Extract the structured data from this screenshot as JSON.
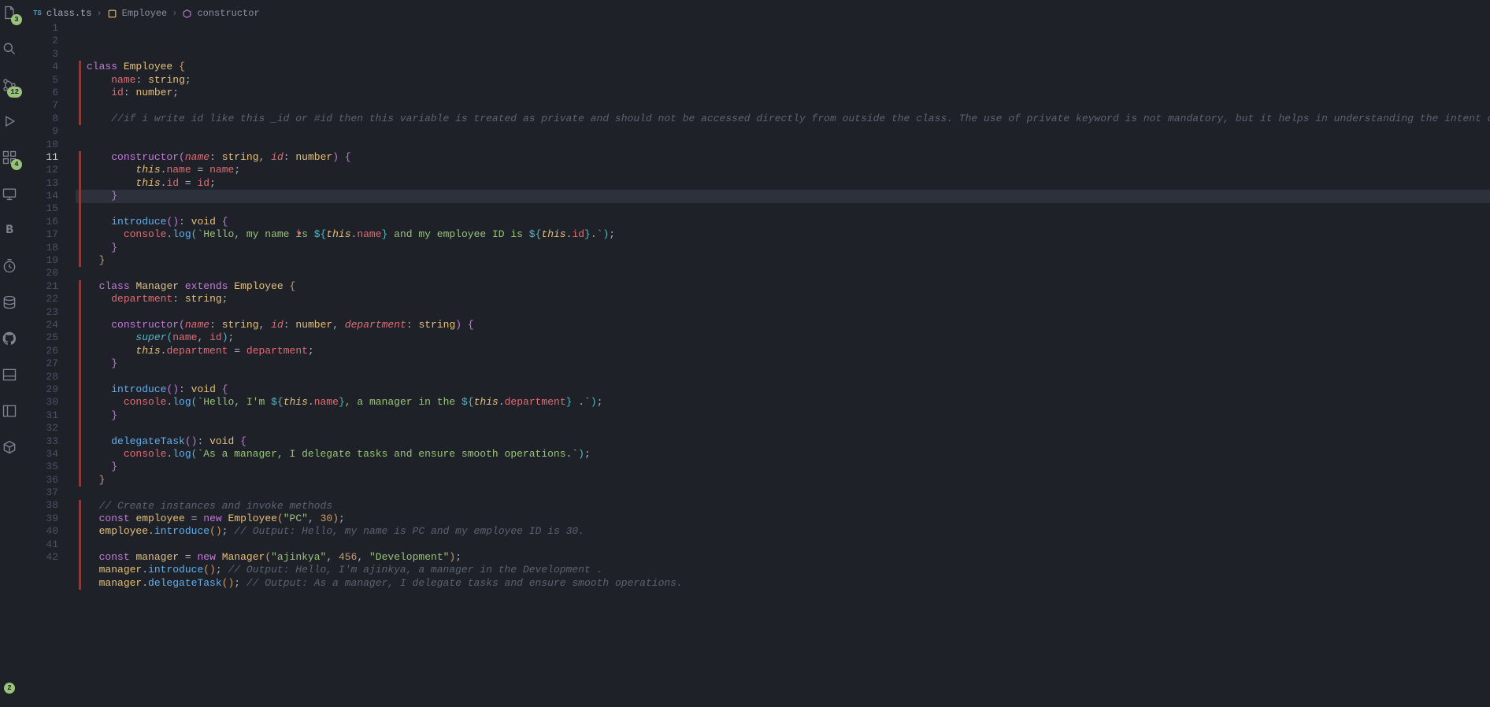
{
  "activity": {
    "badges": {
      "explorer": "3",
      "scm": "12",
      "ext": "4",
      "account": "2"
    }
  },
  "breadcrumb": {
    "tsLabel": "TS",
    "file": "class.ts",
    "class": "Employee",
    "method": "constructor"
  },
  "currentLine": 11,
  "lines": [
    {
      "n": 1,
      "mod": true,
      "html": "<span class='tok-keyword'>class</span> <span class='tok-class'>Employee</span> <span class='tok-brace1'>{</span>"
    },
    {
      "n": 2,
      "mod": true,
      "html": "    <span class='tok-prop'>name</span><span class='tok-punct'>:</span> <span class='tok-type'>string</span><span class='tok-punct'>;</span>"
    },
    {
      "n": 3,
      "mod": true,
      "html": "    <span class='tok-prop'>id</span><span class='tok-punct'>:</span> <span class='tok-type'>number</span><span class='tok-punct'>;</span>"
    },
    {
      "n": 4,
      "mod": true,
      "html": ""
    },
    {
      "n": 5,
      "mod": true,
      "html": "    <span class='tok-comment'>//if i write id like this _id or #id then this variable is treated as private and should not be accessed directly from outside the class. The use of private keyword is not mandatory, but it helps in understanding the intent of the variables. ('only for knowledge purpose')</span>"
    },
    {
      "n": 6,
      "mod": false,
      "html": ""
    },
    {
      "n": 7,
      "mod": false,
      "html": ""
    },
    {
      "n": 8,
      "mod": true,
      "html": "    <span class='tok-keyword'>constructor</span><span class='tok-brace2'>(</span><span class='tok-param'>name</span><span class='tok-punct'>:</span> <span class='tok-type'>string</span><span class='tok-punct'>,</span> <span class='tok-param'>id</span><span class='tok-punct'>:</span> <span class='tok-type'>number</span><span class='tok-brace2'>)</span> <span class='tok-brace2'>{</span>"
    },
    {
      "n": 9,
      "mod": true,
      "html": "        <span class='tok-this'>this</span><span class='tok-punct'>.</span><span class='tok-prop'>name</span> <span class='tok-punct'>=</span> <span class='tok-prop'>name</span><span class='tok-punct'>;</span>"
    },
    {
      "n": 10,
      "mod": true,
      "html": "        <span class='tok-this'>this</span><span class='tok-punct'>.</span><span class='tok-prop'>id</span> <span class='tok-punct'>=</span> <span class='tok-prop'>id</span><span class='tok-punct'>;</span>"
    },
    {
      "n": 11,
      "mod": true,
      "html": "    <span class='tok-brace2'>}</span>"
    },
    {
      "n": 12,
      "mod": true,
      "html": ""
    },
    {
      "n": 13,
      "mod": true,
      "html": "    <span class='tok-func'>introduce</span><span class='tok-brace2'>()</span><span class='tok-punct'>:</span> <span class='tok-type'>void</span> <span class='tok-brace2'>{</span>"
    },
    {
      "n": 14,
      "mod": true,
      "html": "      <span class='tok-prop'>console</span><span class='tok-punct'>.</span><span class='tok-func'>log</span><span class='tok-brace3'>(</span><span class='tok-string'>`Hello, my name is </span><span class='tok-tmpl'>${</span><span class='tok-this'>this</span><span class='tok-punct'>.</span><span class='tok-prop'>name</span><span class='tok-tmpl'>}</span><span class='tok-string'> and my employee ID is </span><span class='tok-tmpl'>${</span><span class='tok-this'>this</span><span class='tok-punct'>.</span><span class='tok-prop'>id</span><span class='tok-tmpl'>}</span><span class='tok-string'>.`</span><span class='tok-brace3'>)</span><span class='tok-punct'>;</span>"
    },
    {
      "n": 15,
      "mod": true,
      "html": "    <span class='tok-brace2'>}</span>"
    },
    {
      "n": 16,
      "mod": true,
      "html": "  <span class='tok-brace1'>}</span>"
    },
    {
      "n": 17,
      "mod": false,
      "html": ""
    },
    {
      "n": 18,
      "mod": true,
      "html": "  <span class='tok-keyword'>class</span> <span class='tok-class'>Manager</span> <span class='tok-keyword'>extends</span> <span class='tok-class'>Employee</span> <span class='tok-brace1'>{</span>"
    },
    {
      "n": 19,
      "mod": true,
      "html": "    <span class='tok-prop'>department</span><span class='tok-punct'>:</span> <span class='tok-type'>string</span><span class='tok-punct'>;</span>"
    },
    {
      "n": 20,
      "mod": true,
      "html": ""
    },
    {
      "n": 21,
      "mod": true,
      "html": "    <span class='tok-keyword'>constructor</span><span class='tok-brace2'>(</span><span class='tok-param'>name</span><span class='tok-punct'>:</span> <span class='tok-type'>string</span><span class='tok-punct'>,</span> <span class='tok-param'>id</span><span class='tok-punct'>:</span> <span class='tok-type'>number</span><span class='tok-punct'>,</span> <span class='tok-param'>department</span><span class='tok-punct'>:</span> <span class='tok-type'>string</span><span class='tok-brace2'>)</span> <span class='tok-brace2'>{</span>"
    },
    {
      "n": 22,
      "mod": true,
      "html": "        <span class='tok-super'>super</span><span class='tok-brace3'>(</span><span class='tok-prop'>name</span><span class='tok-punct'>,</span> <span class='tok-prop'>id</span><span class='tok-brace3'>)</span><span class='tok-punct'>;</span>"
    },
    {
      "n": 23,
      "mod": true,
      "html": "        <span class='tok-this'>this</span><span class='tok-punct'>.</span><span class='tok-prop'>department</span> <span class='tok-punct'>=</span> <span class='tok-prop'>department</span><span class='tok-punct'>;</span>"
    },
    {
      "n": 24,
      "mod": true,
      "html": "    <span class='tok-brace2'>}</span>"
    },
    {
      "n": 25,
      "mod": true,
      "html": ""
    },
    {
      "n": 26,
      "mod": true,
      "html": "    <span class='tok-func'>introduce</span><span class='tok-brace2'>()</span><span class='tok-punct'>:</span> <span class='tok-type'>void</span> <span class='tok-brace2'>{</span>"
    },
    {
      "n": 27,
      "mod": true,
      "html": "      <span class='tok-prop'>console</span><span class='tok-punct'>.</span><span class='tok-func'>log</span><span class='tok-brace3'>(</span><span class='tok-string'>`Hello, I'm </span><span class='tok-tmpl'>${</span><span class='tok-this'>this</span><span class='tok-punct'>.</span><span class='tok-prop'>name</span><span class='tok-tmpl'>}</span><span class='tok-string'>, a manager in the </span><span class='tok-tmpl'>${</span><span class='tok-this'>this</span><span class='tok-punct'>.</span><span class='tok-prop'>department</span><span class='tok-tmpl'>}</span><span class='tok-string'> .`</span><span class='tok-brace3'>)</span><span class='tok-punct'>;</span>"
    },
    {
      "n": 28,
      "mod": true,
      "html": "    <span class='tok-brace2'>}</span>"
    },
    {
      "n": 29,
      "mod": true,
      "html": ""
    },
    {
      "n": 30,
      "mod": true,
      "html": "    <span class='tok-func'>delegateTask</span><span class='tok-brace2'>()</span><span class='tok-punct'>:</span> <span class='tok-type'>void</span> <span class='tok-brace2'>{</span>"
    },
    {
      "n": 31,
      "mod": true,
      "html": "      <span class='tok-prop'>console</span><span class='tok-punct'>.</span><span class='tok-func'>log</span><span class='tok-brace3'>(</span><span class='tok-string'>`As a manager, I delegate tasks and ensure smooth operations.`</span><span class='tok-brace3'>)</span><span class='tok-punct'>;</span>"
    },
    {
      "n": 32,
      "mod": true,
      "html": "    <span class='tok-brace2'>}</span>"
    },
    {
      "n": 33,
      "mod": true,
      "html": "  <span class='tok-brace1'>}</span>"
    },
    {
      "n": 34,
      "mod": false,
      "html": ""
    },
    {
      "n": 35,
      "mod": true,
      "html": "  <span class='tok-comment'>// Create instances and invoke methods</span>"
    },
    {
      "n": 36,
      "mod": true,
      "html": "  <span class='tok-keyword'>const</span> <span class='tok-const'>employee</span> <span class='tok-punct'>=</span> <span class='tok-keyword'>new</span> <span class='tok-class'>Employee</span><span class='tok-brace1'>(</span><span class='tok-string'>\"PC\"</span><span class='tok-punct'>,</span> <span class='tok-num'>30</span><span class='tok-brace1'>)</span><span class='tok-punct'>;</span>"
    },
    {
      "n": 37,
      "mod": true,
      "html": "  <span class='tok-const'>employee</span><span class='tok-punct'>.</span><span class='tok-func'>introduce</span><span class='tok-brace1'>()</span><span class='tok-punct'>;</span> <span class='tok-comment'>// Output: Hello, my name is PC and my employee ID is 30.</span>"
    },
    {
      "n": 38,
      "mod": true,
      "html": ""
    },
    {
      "n": 39,
      "mod": true,
      "html": "  <span class='tok-keyword'>const</span> <span class='tok-const'>manager</span> <span class='tok-punct'>=</span> <span class='tok-keyword'>new</span> <span class='tok-class'>Manager</span><span class='tok-brace1'>(</span><span class='tok-string'>\"ajinkya\"</span><span class='tok-punct'>,</span> <span class='tok-num'>456</span><span class='tok-punct'>,</span> <span class='tok-string'>\"Development\"</span><span class='tok-brace1'>)</span><span class='tok-punct'>;</span>"
    },
    {
      "n": 40,
      "mod": true,
      "html": "  <span class='tok-const'>manager</span><span class='tok-punct'>.</span><span class='tok-func'>introduce</span><span class='tok-brace1'>()</span><span class='tok-punct'>;</span> <span class='tok-comment'>// Output: Hello, I'm ajinkya, a manager in the Development .</span>"
    },
    {
      "n": 41,
      "mod": true,
      "html": "  <span class='tok-const'>manager</span><span class='tok-punct'>.</span><span class='tok-func'>delegateTask</span><span class='tok-brace1'>()</span><span class='tok-punct'>;</span> <span class='tok-comment'>// Output: As a manager, I delegate tasks and ensure smooth operations.</span>"
    },
    {
      "n": 42,
      "mod": false,
      "html": ""
    }
  ]
}
